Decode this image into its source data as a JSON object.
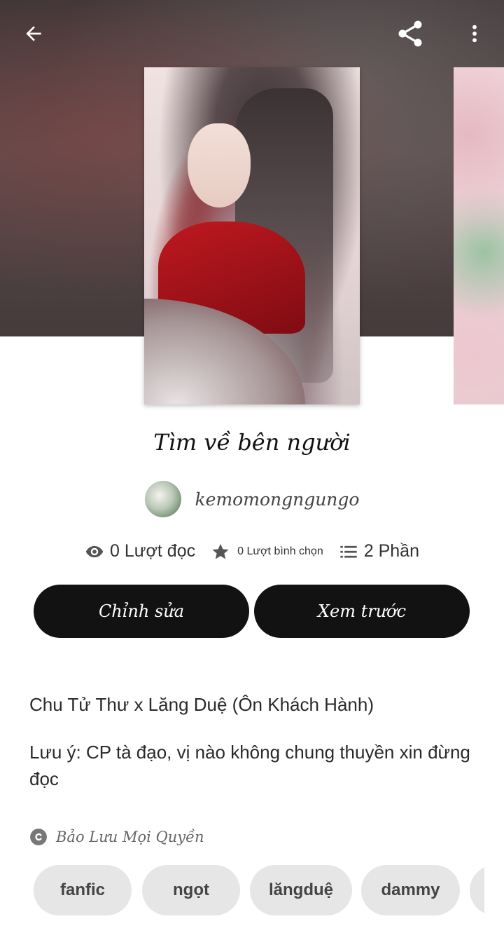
{
  "story": {
    "title": "Tìm về bên người",
    "author": "kemomongngungo"
  },
  "stats": {
    "reads": "0 Lượt đọc",
    "votes": "0 Lượt bình chọn",
    "parts": "2 Phần"
  },
  "actions": {
    "edit_label": "Chỉnh sửa",
    "preview_label": "Xem trước"
  },
  "description": {
    "line1": "Chu Tử Thư x Lăng Duệ (Ôn Khách Hành)",
    "line2": "Lưu ý: CP tà đạo, vị nào không chung thuyền xin đừng đọc"
  },
  "copyright": {
    "label": "Bảo Lưu Mọi Quyền",
    "icon": "copyright-icon"
  },
  "tags": [
    "fanfic",
    "ngọt",
    "lăngduệ",
    "dammy"
  ],
  "icons": {
    "back": "back-arrow-icon",
    "share": "share-icon",
    "more": "more-vert-icon",
    "reads": "eye-icon",
    "votes": "star-icon",
    "parts": "list-icon"
  },
  "colors": {
    "button_bg": "#121212",
    "tag_bg": "#e6e6e6",
    "text": "#222222"
  }
}
